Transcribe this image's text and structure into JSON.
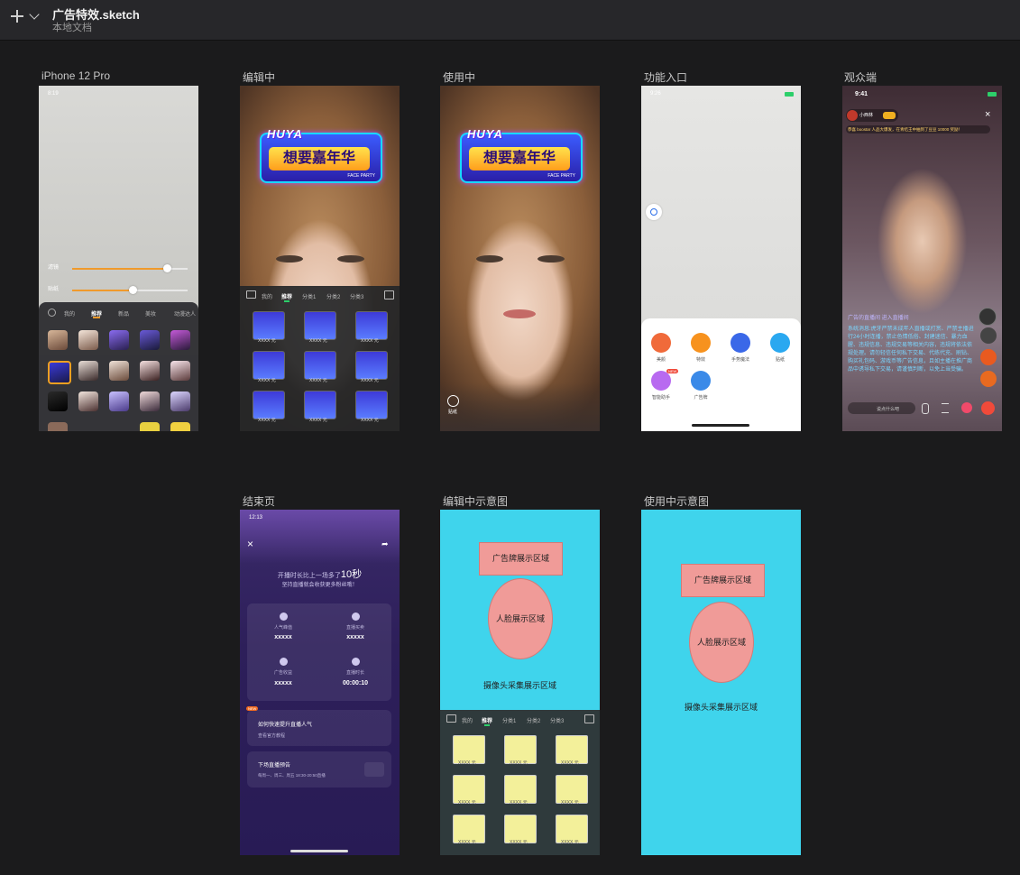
{
  "app": {
    "doc_title": "广告特效.sketch",
    "doc_sub": "本地文档"
  },
  "artboards": {
    "b1": {
      "label": "iPhone 12 Pro",
      "time": "8:19",
      "slider1": "滤镜",
      "slider2": "贴纸",
      "slider1_level": 0.82,
      "slider2_level": 0.52,
      "tabs": [
        "我的",
        "推荐",
        "新品",
        "美妆",
        "动漫达人"
      ]
    },
    "b2": {
      "label": "编辑中",
      "banner_top": "HUYA",
      "banner_main": "想要嘉年华",
      "banner_small": "FACE PARTY",
      "tabs": [
        "我的",
        "推荐",
        "分类1",
        "分类2",
        "分类3"
      ],
      "tile_label": "XXXX 元"
    },
    "b3": {
      "label": "使用中",
      "banner_top": "HUYA",
      "banner_main": "想要嘉年华",
      "banner_small": "FACE PARTY",
      "corner": "贴纸"
    },
    "b4": {
      "label": "功能入口",
      "time": "9:26",
      "items": [
        "美颜",
        "特效",
        "手势魔法",
        "贴纸",
        "智能助手",
        "广告牌"
      ],
      "item_badge": "NEW"
    },
    "b5": {
      "label": "观众端",
      "time": "9:41",
      "anchor": "小西林",
      "notice": "恭喜 boostar 人品大爆发，在青桔王中抽到了豆豆 10000 奖励！",
      "chat": [
        "广告的直播间 进入直播间",
        "系统消息:虎牙严禁未成年人直播或打赏、严禁主播进行24小时连播，禁止色情低俗、封建迷信、暴力血腥、违规信息、违规交易等相关内容，违规将依法依规处理。请勿轻信任何私下交易、代练代充、刷钻、购买礼包码、游戏币等广告信息，且如主播在推广商品中诱导私下交易，请谨慎判断，以免上当受骗。"
      ],
      "input_placeholder": "说点什么吧"
    },
    "b6": {
      "label": "结束页",
      "time": "12:13",
      "line1_prefix": "开播时长比上一场多了",
      "line1_value": "10秒",
      "line2": "坚持直播就会收获更多粉丝哦！",
      "stats": [
        {
          "label": "人气峰值",
          "value": "xxxxx"
        },
        {
          "label": "直播买卖",
          "value": "xxxxx"
        },
        {
          "label": "广告收益",
          "value": "xxxxx"
        },
        {
          "label": "直播时长",
          "value": "00:00:10"
        }
      ],
      "card1_badge": "NEW",
      "card1_title": "如何快速提升直播人气",
      "card1_link": "查看官方教程",
      "card2_title": "下场直播预告",
      "card2_sub": "每周一、周三、周五 18:30-20:50直播"
    },
    "b7": {
      "label": "编辑中示意图",
      "ad_area": "广告牌展示区域",
      "face_area": "人脸展示区域",
      "cam_area": "摄像头采集展示区域",
      "tabs": [
        "我的",
        "推荐",
        "分类1",
        "分类2",
        "分类3"
      ],
      "tile_label": "XXXX 元"
    },
    "b8": {
      "label": "使用中示意图",
      "ad_area": "广告牌展示区域",
      "face_area": "人脸展示区域",
      "cam_area": "摄像头采集展示区域"
    }
  },
  "colors": {
    "canvas": "#1b1b1c",
    "schematic_bg": "#3fd4ec",
    "schematic_box": "#f09b98",
    "accent_orange": "#f09a2c"
  }
}
